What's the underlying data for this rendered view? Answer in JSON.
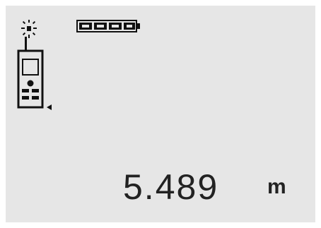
{
  "display": {
    "measurement": "5.489",
    "unit": "m",
    "battery_level": 1.0,
    "reference_point": "rear-edge",
    "laser_status": "on"
  },
  "icons": {
    "laser": "laser-beam-icon",
    "battery": "battery-icon",
    "device": "device-reference-icon",
    "reference_marker": "triangle-left-icon"
  }
}
